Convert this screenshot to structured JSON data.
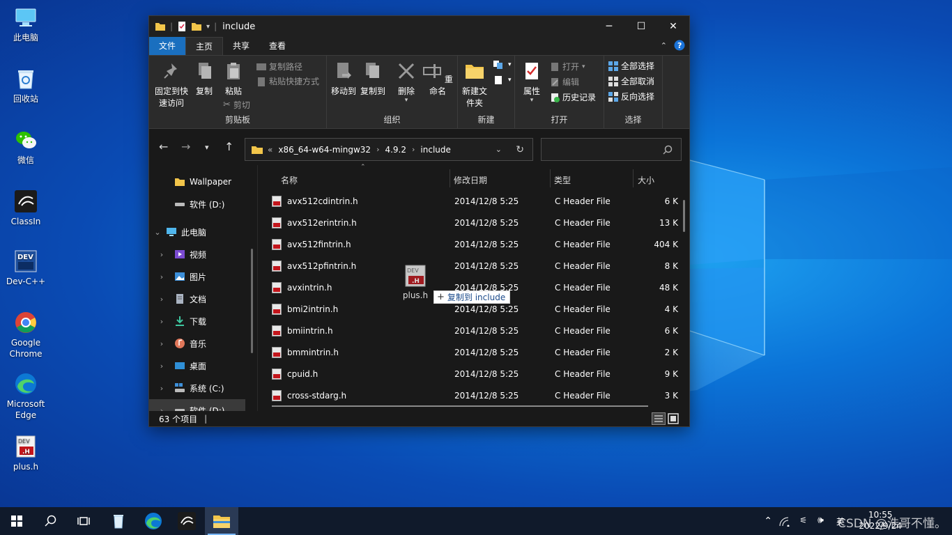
{
  "desktop": {
    "icons": [
      {
        "label": "此电脑"
      },
      {
        "label": "回收站"
      },
      {
        "label": "微信"
      },
      {
        "label": "ClassIn"
      },
      {
        "label": "Dev-C++"
      },
      {
        "label": "Google Chrome"
      },
      {
        "label": "Microsoft Edge"
      },
      {
        "label": "plus.h"
      }
    ]
  },
  "window": {
    "title": "include",
    "tabs": {
      "file": "文件",
      "home": "主页",
      "share": "共享",
      "view": "查看"
    },
    "ribbon": {
      "clipboard": {
        "pin": "固定到快速访问",
        "copy": "复制",
        "paste": "粘贴",
        "copy_path": "复制路径",
        "paste_shortcut": "粘贴快捷方式",
        "cut": "剪切",
        "label": "剪贴板"
      },
      "organize": {
        "move_to": "移动到",
        "copy_to": "复制到",
        "delete": "删除",
        "rename": "重命名",
        "label": "组织"
      },
      "new": {
        "new_folder": "新建文件夹",
        "label": "新建"
      },
      "open": {
        "properties": "属性",
        "open": "打开",
        "edit": "编辑",
        "history": "历史记录",
        "label": "打开"
      },
      "select": {
        "select_all": "全部选择",
        "select_none": "全部取消",
        "invert": "反向选择",
        "label": "选择"
      }
    },
    "address": {
      "overflow": "«",
      "crumbs": [
        "x86_64-w64-mingw32",
        "4.9.2",
        "include"
      ],
      "search_placeholder": ""
    },
    "nav": {
      "items": [
        {
          "label": "Wallpaper"
        },
        {
          "label": "软件 (D:)"
        },
        {
          "label": "此电脑"
        },
        {
          "label": "视频"
        },
        {
          "label": "图片"
        },
        {
          "label": "文档"
        },
        {
          "label": "下载"
        },
        {
          "label": "音乐"
        },
        {
          "label": "桌面"
        },
        {
          "label": "系统 (C:)"
        },
        {
          "label": "软件 (D:)"
        }
      ]
    },
    "columns": {
      "name": "名称",
      "date": "修改日期",
      "type": "类型",
      "size": "大小"
    },
    "files": [
      {
        "name": "avx512cdintrin.h",
        "date": "2014/12/8 5:25",
        "type": "C Header File",
        "size": "6 K"
      },
      {
        "name": "avx512erintrin.h",
        "date": "2014/12/8 5:25",
        "type": "C Header File",
        "size": "13 K"
      },
      {
        "name": "avx512fintrin.h",
        "date": "2014/12/8 5:25",
        "type": "C Header File",
        "size": "404 K"
      },
      {
        "name": "avx512pfintrin.h",
        "date": "2014/12/8 5:25",
        "type": "C Header File",
        "size": "8 K"
      },
      {
        "name": "avxintrin.h",
        "date": "2014/12/8 5:25",
        "type": "C Header File",
        "size": "48 K"
      },
      {
        "name": "bmi2intrin.h",
        "date": "2014/12/8 5:25",
        "type": "C Header File",
        "size": "4 K"
      },
      {
        "name": "bmiintrin.h",
        "date": "2014/12/8 5:25",
        "type": "C Header File",
        "size": "6 K"
      },
      {
        "name": "bmmintrin.h",
        "date": "2014/12/8 5:25",
        "type": "C Header File",
        "size": "2 K"
      },
      {
        "name": "cpuid.h",
        "date": "2014/12/8 5:25",
        "type": "C Header File",
        "size": "9 K"
      },
      {
        "name": "cross-stdarg.h",
        "date": "2014/12/8 5:25",
        "type": "C Header File",
        "size": "3 K"
      }
    ],
    "status": "63 个项目"
  },
  "drag": {
    "file_label": "plus.h",
    "tooltip": "复制到 include"
  },
  "taskbar": {
    "tray_ime": "英",
    "time": "10:55",
    "date": "2022/9/24",
    "watermark": "CSDN @浩哥不懂。"
  }
}
